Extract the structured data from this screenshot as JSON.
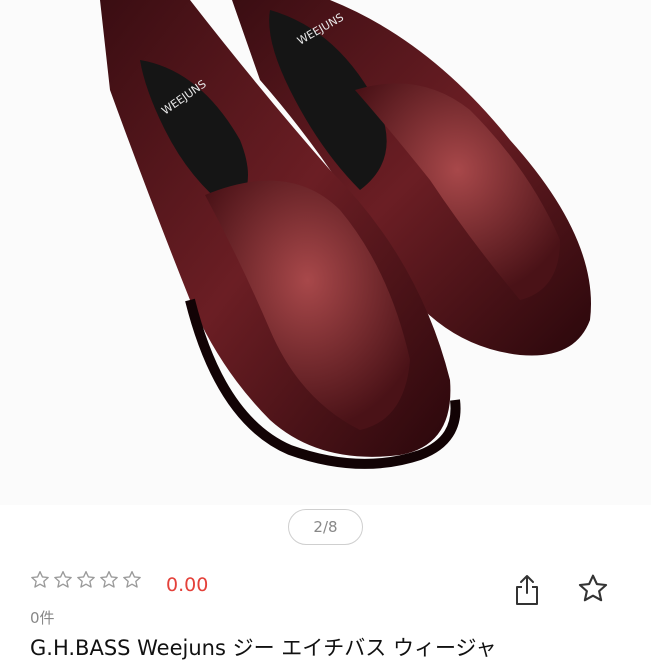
{
  "gallery": {
    "pager_text": "2/8",
    "image_alt": "G.H. BASS Weejuns penny loafers in burgundy leather"
  },
  "rating": {
    "score": "0.00",
    "review_count": "0件",
    "max_stars": 5,
    "filled_stars": 0
  },
  "product": {
    "title": "G.H.BASS Weejuns ジー エイチバス ウィージャ"
  },
  "colors": {
    "score": "#e4413a",
    "star_outline": "#9a9a9a"
  },
  "icons": {
    "share": "share-icon",
    "favorite": "star-outline-icon"
  }
}
